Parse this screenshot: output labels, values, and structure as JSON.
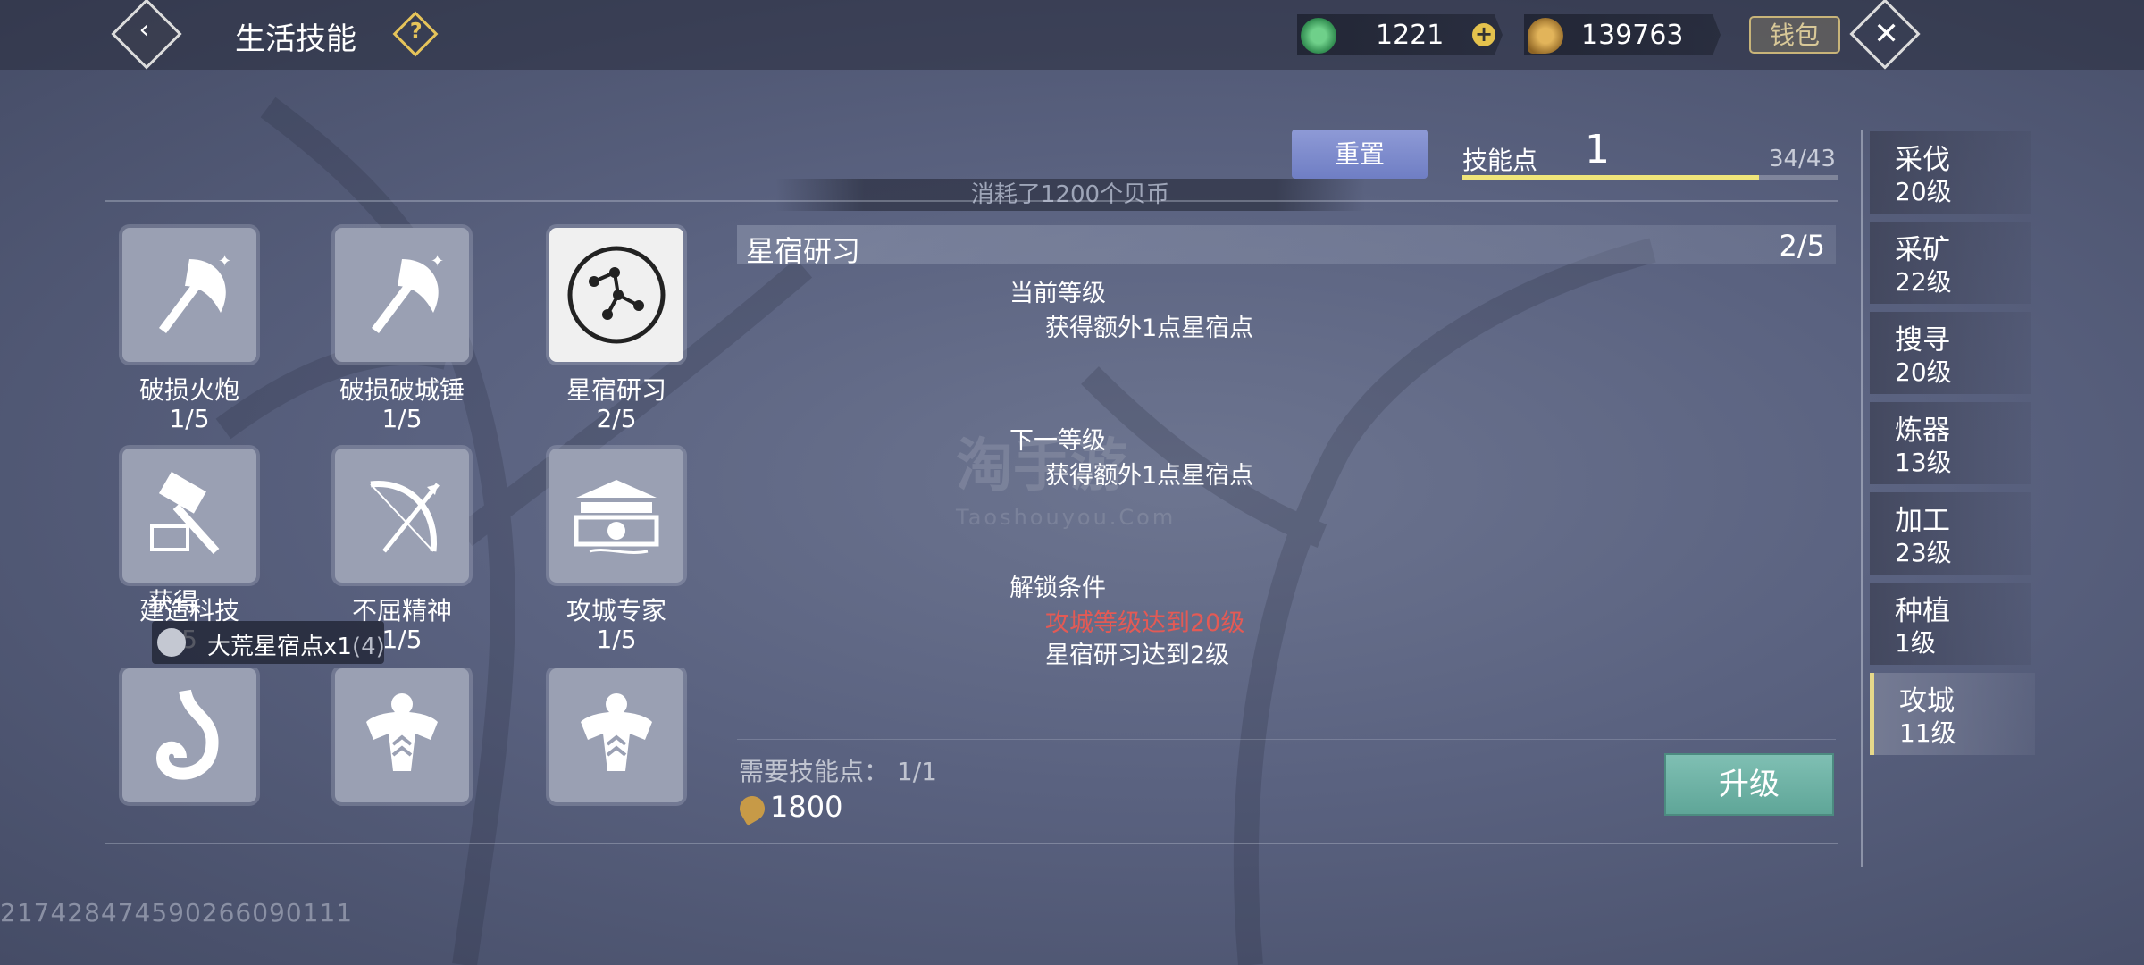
{
  "header": {
    "title": "生活技能",
    "currency_jade": "1221",
    "currency_shell": "139763",
    "wallet_label": "钱包"
  },
  "skill_points": {
    "reset_label": "重置",
    "label": "技能点",
    "value": "1",
    "progress_text": "34/43",
    "progress_fraction": 0.79
  },
  "cost_banner": "消耗了1200个贝币",
  "skills": [
    {
      "name": "破损火炮",
      "level": "1/5"
    },
    {
      "name": "破损破城锤",
      "level": "1/5"
    },
    {
      "name": "星宿研习",
      "level": "2/5"
    },
    {
      "name": "建造科技",
      "level": "5"
    },
    {
      "name": "不屈精神",
      "level": "1/5"
    },
    {
      "name": "攻城专家",
      "level": "1/5"
    }
  ],
  "overlay": {
    "gain_label": "获得",
    "item_name": "大荒星宿点x1",
    "item_count": "(4)"
  },
  "detail": {
    "title": "星宿研习",
    "level": "2/5",
    "current_label": "当前等级",
    "current_text": "获得额外1点星宿点",
    "next_label": "下一等级",
    "next_text": "获得额外1点星宿点",
    "unlock_label": "解锁条件",
    "unlock_req1": "攻城等级达到20级",
    "unlock_req2": "星宿研习达到2级",
    "need_label": "需要技能点：",
    "need_value": "1/1",
    "cost": "1800",
    "upgrade_label": "升级"
  },
  "tabs": [
    {
      "name": "采伐",
      "level": "20级"
    },
    {
      "name": "采矿",
      "level": "22级"
    },
    {
      "name": "搜寻",
      "level": "20级"
    },
    {
      "name": "炼器",
      "level": "13级"
    },
    {
      "name": "加工",
      "level": "23级"
    },
    {
      "name": "种植",
      "level": "1级"
    },
    {
      "name": "攻城",
      "level": "11级"
    }
  ],
  "footer_id": "217428474590266090111",
  "watermark": "淘手游",
  "watermark_url": "Taoshouyou.Com"
}
